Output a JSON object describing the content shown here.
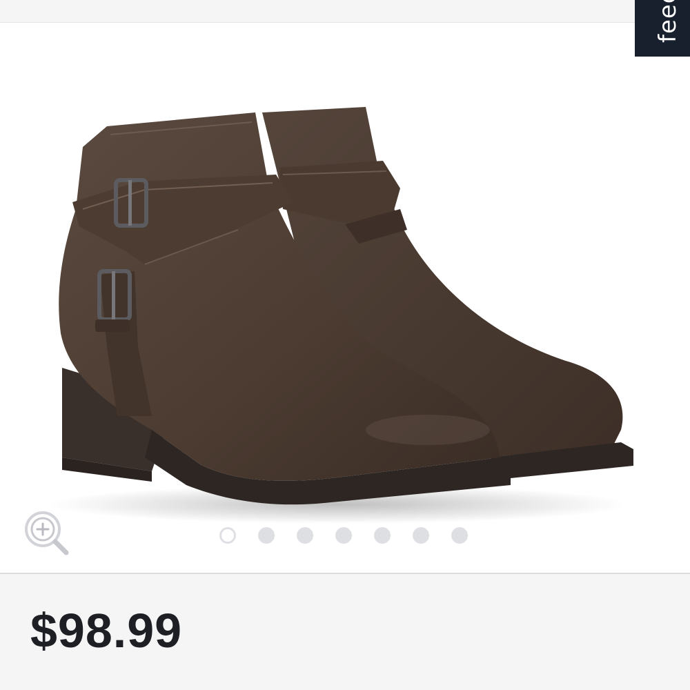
{
  "feedback_tab": {
    "label": "feedback",
    "bg_color": "#17202c"
  },
  "gallery": {
    "image_description_icon": "brown-ankle-boots-image",
    "zoom_icon": "zoom-in-icon",
    "dots_count": 7,
    "active_dot_index": 0
  },
  "product": {
    "price": "$98.99"
  },
  "colors": {
    "price_text": "#1d1f24",
    "dot_inactive": "#dedfe3",
    "boot_brown": "#4e3d33"
  }
}
